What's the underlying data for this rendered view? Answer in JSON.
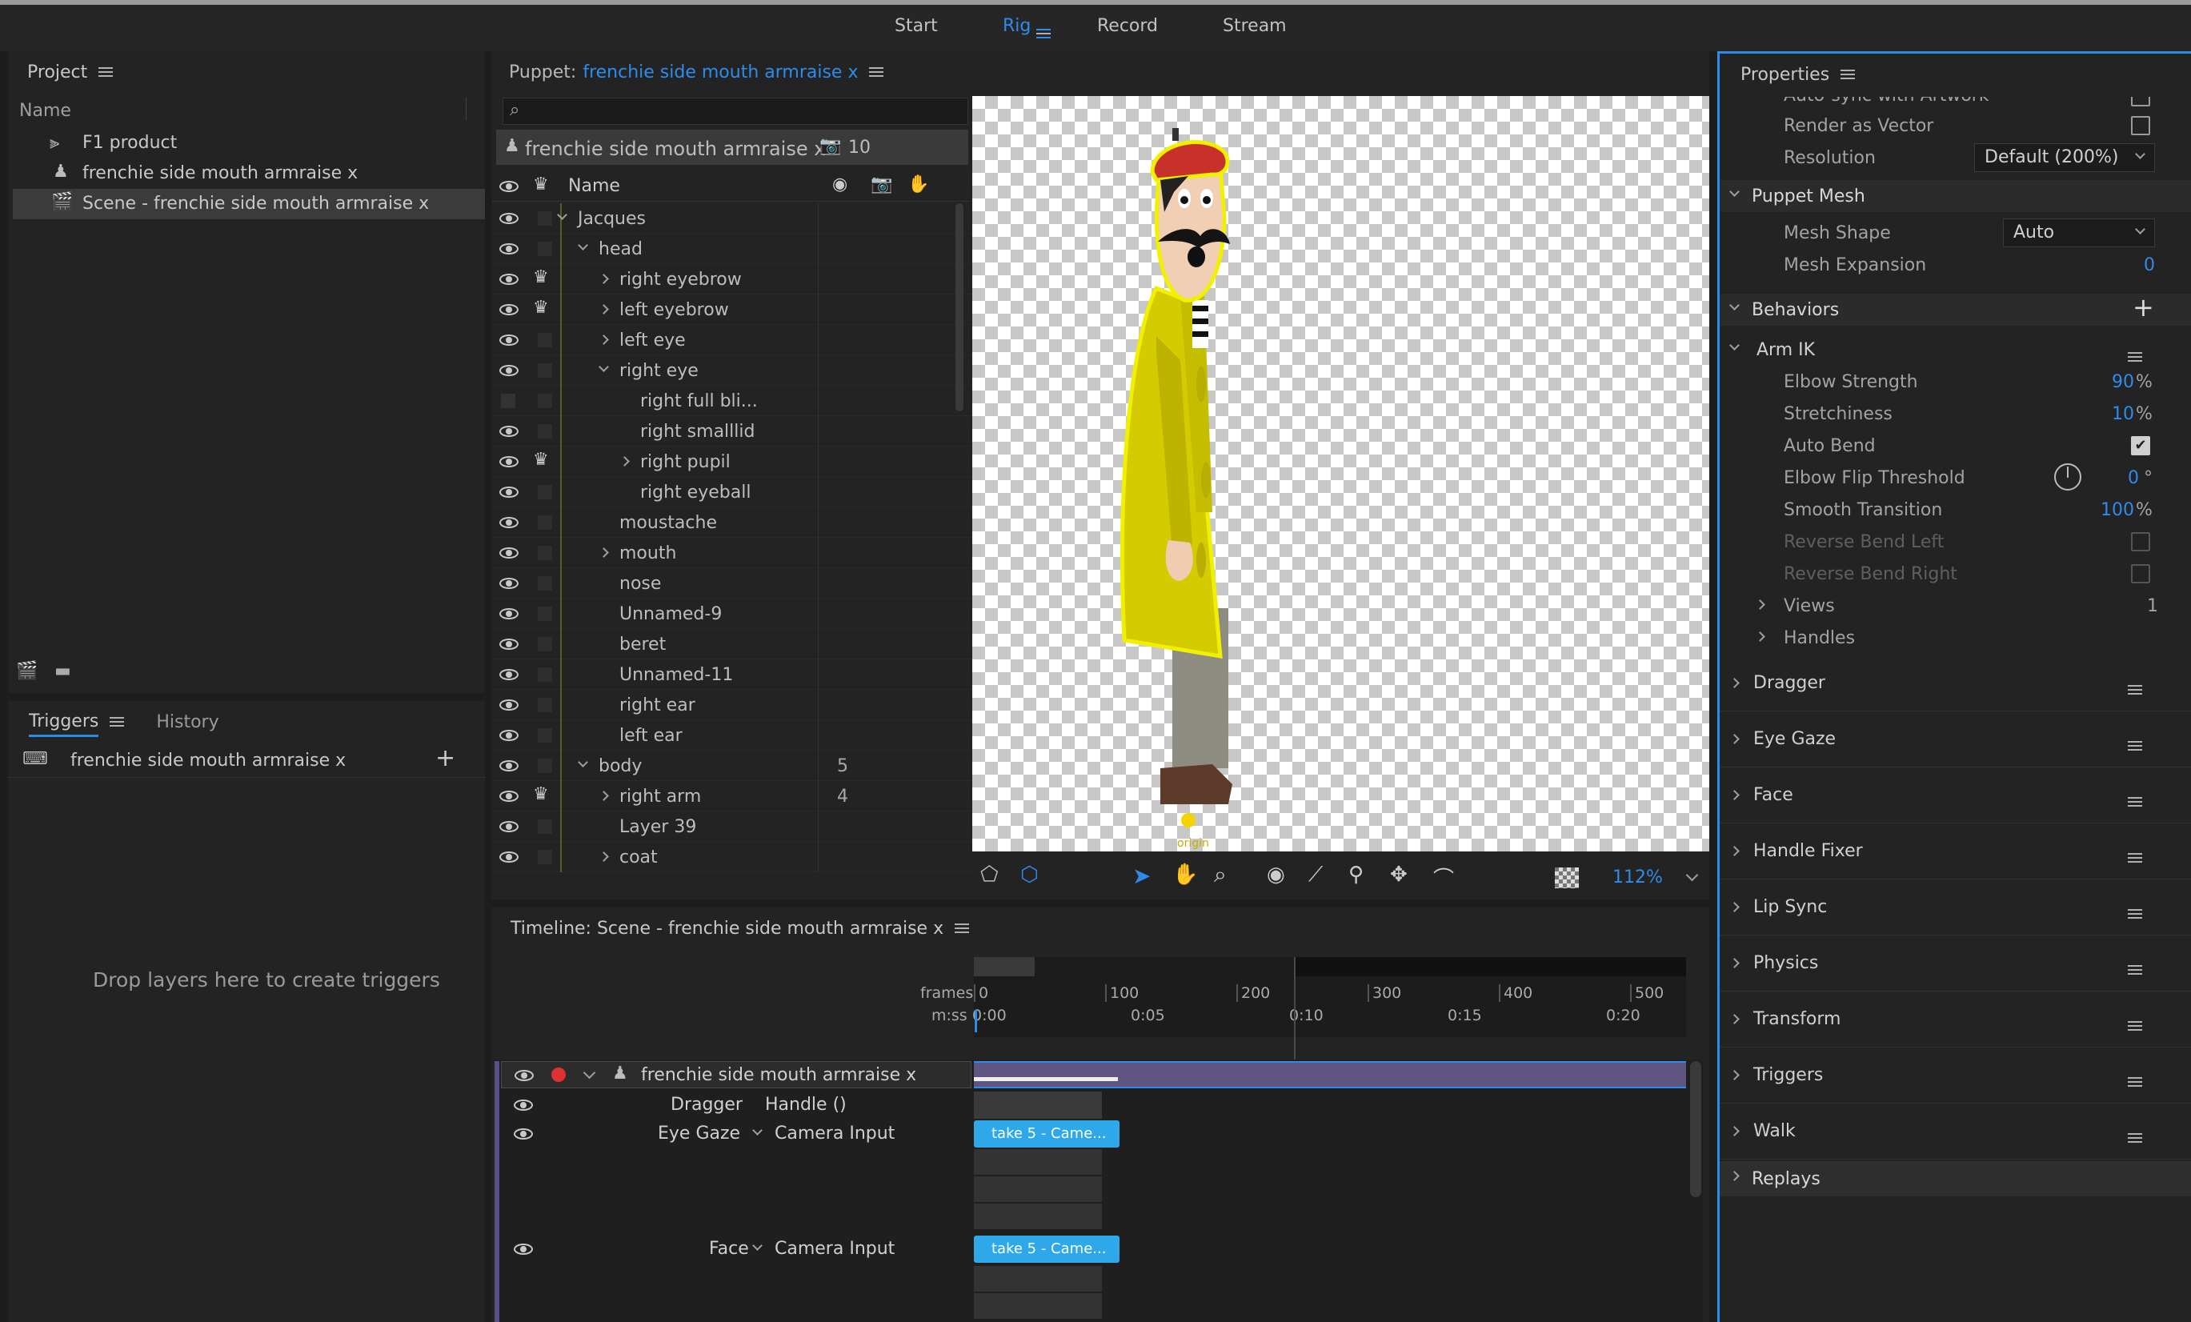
{
  "workspace": {
    "tabs": [
      "Start",
      "Rig",
      "Record",
      "Stream"
    ],
    "active": "Rig"
  },
  "project": {
    "title": "Project",
    "column": "Name",
    "items": [
      "F1 product",
      "frenchie side mouth armraise x",
      "Scene - frenchie side mouth armraise x"
    ]
  },
  "triggers": {
    "tab1": "Triggers",
    "tab2": "History",
    "item": "frenchie side mouth armraise x",
    "empty": "Drop layers here to create triggers"
  },
  "puppet": {
    "prefix": "Puppet:",
    "name": "frenchie side mouth armraise x",
    "root": "frenchie side mouth armraise x",
    "count": "10",
    "col_name": "Name",
    "layers": [
      {
        "l": "Jacques",
        "x": 1,
        "i": "d",
        "c": "",
        "eye": 1,
        "cr": 0
      },
      {
        "l": "head",
        "x": 2,
        "i": "d",
        "c": "",
        "eye": 1,
        "cr": 0
      },
      {
        "l": "right eyebrow",
        "x": 3,
        "i": "r",
        "c": "",
        "eye": 1,
        "cr": 1
      },
      {
        "l": "left eyebrow",
        "x": 3,
        "i": "r",
        "c": "",
        "eye": 1,
        "cr": 1
      },
      {
        "l": "left eye",
        "x": 3,
        "i": "r",
        "c": "",
        "eye": 1,
        "cr": 0
      },
      {
        "l": "right eye",
        "x": 3,
        "i": "d",
        "c": "",
        "eye": 1,
        "cr": 0
      },
      {
        "l": "right full bli...",
        "x": 4,
        "i": "",
        "c": "",
        "eye": 0,
        "cr": 0
      },
      {
        "l": "right smalllid",
        "x": 4,
        "i": "",
        "c": "",
        "eye": 1,
        "cr": 0
      },
      {
        "l": "right pupil",
        "x": 4,
        "i": "r",
        "c": "",
        "eye": 1,
        "cr": 1
      },
      {
        "l": "right eyeball",
        "x": 4,
        "i": "",
        "c": "",
        "eye": 1,
        "cr": 0
      },
      {
        "l": "moustache",
        "x": 3,
        "i": "",
        "c": "",
        "eye": 1,
        "cr": 0
      },
      {
        "l": "mouth",
        "x": 3,
        "i": "r",
        "c": "",
        "eye": 1,
        "cr": 0
      },
      {
        "l": "nose",
        "x": 3,
        "i": "",
        "c": "",
        "eye": 1,
        "cr": 0
      },
      {
        "l": "Unnamed-9",
        "x": 3,
        "i": "",
        "c": "",
        "eye": 1,
        "cr": 0
      },
      {
        "l": "beret",
        "x": 3,
        "i": "",
        "c": "",
        "eye": 1,
        "cr": 0
      },
      {
        "l": "Unnamed-11",
        "x": 3,
        "i": "",
        "c": "",
        "eye": 1,
        "cr": 0
      },
      {
        "l": "right ear",
        "x": 3,
        "i": "",
        "c": "",
        "eye": 1,
        "cr": 0
      },
      {
        "l": "left ear",
        "x": 3,
        "i": "",
        "c": "",
        "eye": 1,
        "cr": 0
      },
      {
        "l": "body",
        "x": 2,
        "i": "d",
        "c": "5",
        "eye": 1,
        "cr": 0
      },
      {
        "l": "right arm",
        "x": 3,
        "i": "r",
        "c": "4",
        "eye": 1,
        "cr": 1
      },
      {
        "l": "Layer 39",
        "x": 3,
        "i": "",
        "c": "",
        "eye": 1,
        "cr": 0
      },
      {
        "l": "coat",
        "x": 3,
        "i": "r",
        "c": "",
        "eye": 1,
        "cr": 0
      }
    ]
  },
  "canvas": {
    "zoom": "112%",
    "origin": "origin"
  },
  "timeline": {
    "title": "Timeline: Scene - frenchie side mouth armraise x",
    "frames_label": "frames",
    "mss_label": "m:ss",
    "frame_ticks": [
      "0",
      "100",
      "200",
      "300",
      "400",
      "500"
    ],
    "time_ticks": [
      "0:00",
      "0:05",
      "0:10",
      "0:15",
      "0:20"
    ],
    "track": "frenchie side mouth armraise x",
    "behaviors": [
      {
        "name": "Dragger",
        "input": "Handle ()"
      },
      {
        "name": "Eye Gaze",
        "input": "Camera Input"
      },
      {
        "name": "Face",
        "input": "Camera Input"
      }
    ],
    "take": "take 5 - Came..."
  },
  "properties": {
    "title": "Properties",
    "cut_row": "Auto-sync with Artwork",
    "render_vector": "Render as Vector",
    "resolution_label": "Resolution",
    "resolution_value": "Default (200%)",
    "mesh_section": "Puppet Mesh",
    "mesh_shape_label": "Mesh Shape",
    "mesh_shape_value": "Auto",
    "mesh_exp_label": "Mesh Expansion",
    "mesh_exp_value": "0",
    "behaviors_section": "Behaviors",
    "armik": "Arm IK",
    "elbow_strength": "Elbow Strength",
    "elbow_strength_v": "90",
    "stretchiness": "Stretchiness",
    "stretchiness_v": "10",
    "auto_bend": "Auto Bend",
    "flip": "Elbow Flip Threshold",
    "flip_v": "0",
    "smooth": "Smooth Transition",
    "smooth_v": "100",
    "rev_left": "Reverse Bend Left",
    "rev_right": "Reverse Bend Right",
    "views": "Views",
    "views_v": "1",
    "handles": "Handles",
    "pct": "%",
    "deg": "°",
    "list": [
      "Dragger",
      "Eye Gaze",
      "Face",
      "Handle Fixer",
      "Lip Sync",
      "Physics",
      "Transform",
      "Triggers",
      "Walk"
    ],
    "replays": "Replays"
  }
}
